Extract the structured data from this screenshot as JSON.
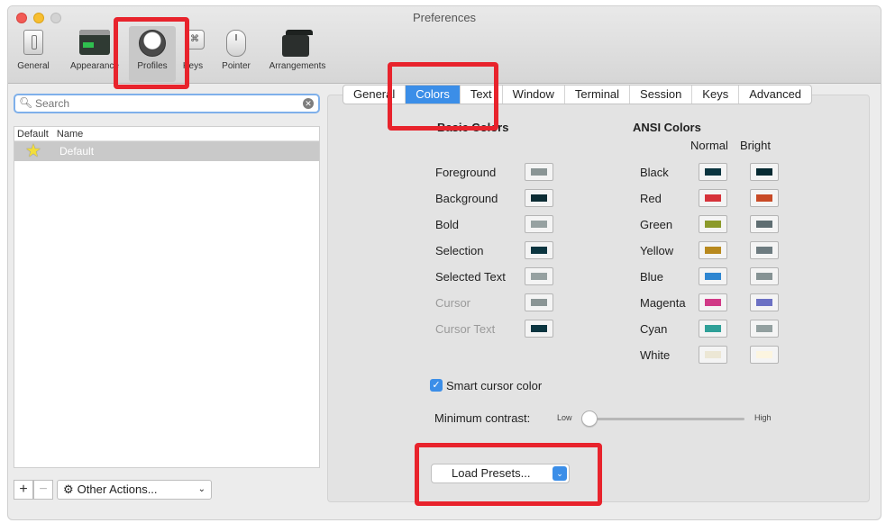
{
  "window": {
    "title": "Preferences"
  },
  "toolbar": {
    "items": [
      {
        "label": "General",
        "icon": "general-switch-icon"
      },
      {
        "label": "Appearance",
        "icon": "appearance-window-icon"
      },
      {
        "label": "Profiles",
        "icon": "profile-person-icon",
        "selected": true
      },
      {
        "label": "Keys",
        "icon": "keyboard-key-icon",
        "glyph": "⌘"
      },
      {
        "label": "Pointer",
        "icon": "mouse-icon"
      },
      {
        "label": "Arrangements",
        "icon": "window-stack-icon"
      }
    ]
  },
  "sidebar": {
    "search_placeholder": "Search",
    "columns": [
      "Default",
      "Name"
    ],
    "profiles": [
      {
        "name": "Default",
        "is_default": true,
        "selected": true
      }
    ],
    "other_actions_label": "Other Actions..."
  },
  "tabs": [
    {
      "label": "General"
    },
    {
      "label": "Colors",
      "active": true
    },
    {
      "label": "Text"
    },
    {
      "label": "Window"
    },
    {
      "label": "Terminal"
    },
    {
      "label": "Session"
    },
    {
      "label": "Keys"
    },
    {
      "label": "Advanced"
    }
  ],
  "basic_colors": {
    "heading": "Basic Colors",
    "rows": [
      {
        "label": "Foreground",
        "color": "#8a9595",
        "disabled": false
      },
      {
        "label": "Background",
        "color": "#0b2b33",
        "disabled": false
      },
      {
        "label": "Bold",
        "color": "#96a1a1",
        "disabled": false
      },
      {
        "label": "Selection",
        "color": "#0b3540",
        "disabled": false
      },
      {
        "label": "Selected Text",
        "color": "#96a1a1",
        "disabled": false
      },
      {
        "label": "Cursor",
        "color": "#8a9595",
        "disabled": true
      },
      {
        "label": "Cursor Text",
        "color": "#0b3540",
        "disabled": true
      }
    ]
  },
  "ansi_colors": {
    "heading": "ANSI Colors",
    "normal_label": "Normal",
    "bright_label": "Bright",
    "rows": [
      {
        "label": "Black",
        "normal": "#0b3540",
        "bright": "#062a32"
      },
      {
        "label": "Red",
        "normal": "#d6323a",
        "bright": "#c84a26"
      },
      {
        "label": "Green",
        "normal": "#8c9a2a",
        "bright": "#5f6e72"
      },
      {
        "label": "Yellow",
        "normal": "#b8891e",
        "bright": "#6d7b80"
      },
      {
        "label": "Blue",
        "normal": "#2e86d1",
        "bright": "#869394"
      },
      {
        "label": "Magenta",
        "normal": "#d13a87",
        "bright": "#6c71c4"
      },
      {
        "label": "Cyan",
        "normal": "#2fa098",
        "bright": "#93a0a0"
      },
      {
        "label": "White",
        "normal": "#ece7d5",
        "bright": "#fcf5e0"
      }
    ]
  },
  "smart_cursor": {
    "label": "Smart cursor color",
    "checked": true
  },
  "min_contrast": {
    "label": "Minimum contrast:",
    "low": "Low",
    "high": "High",
    "value": 0.0
  },
  "load_presets_label": "Load Presets...",
  "annotation_color": "#e8232c"
}
